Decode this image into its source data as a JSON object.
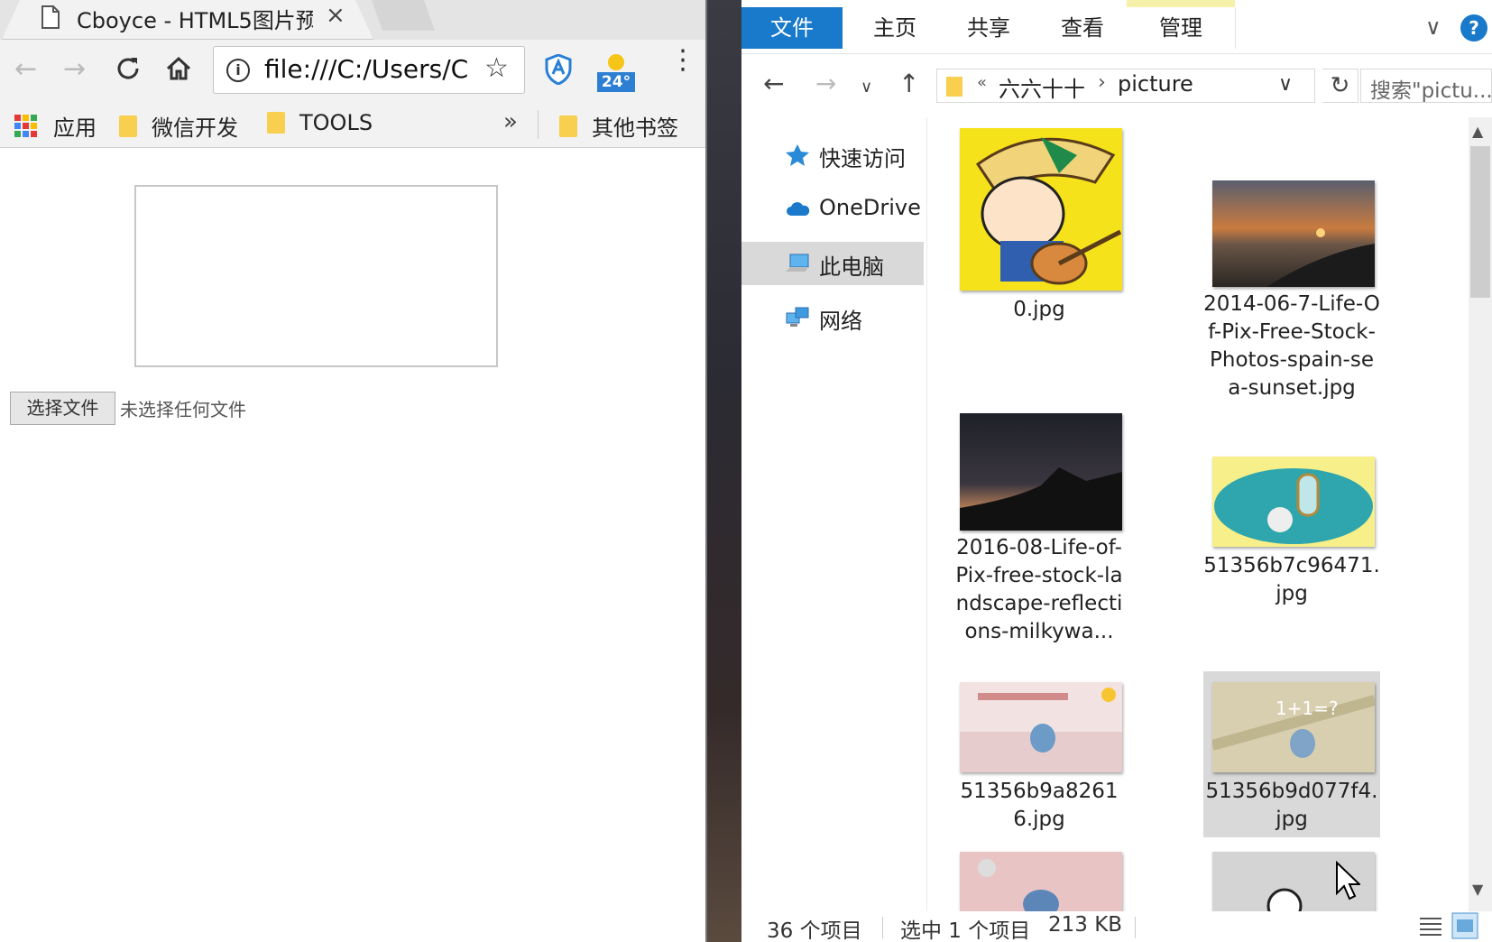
{
  "browser": {
    "tab_title": "Cboyce - HTML5图片预",
    "tab_close": "×",
    "url": "file:///C:/Users/Ca",
    "weather_temp": "24°",
    "bookmarks": {
      "apps": "应用",
      "wechat": "微信开发",
      "tools": "TOOLS",
      "more": "»",
      "other": "其他书签"
    }
  },
  "page": {
    "choose_file_label": "选择文件",
    "no_file_text": "未选择任何文件"
  },
  "explorer": {
    "ribbon_tabs": [
      "文件",
      "主页",
      "共享",
      "查看",
      "管理"
    ],
    "breadcrumb": [
      "六六十十",
      "picture"
    ],
    "search_placeholder": "搜索\"pictu...",
    "nav": [
      {
        "label": "快速访问"
      },
      {
        "label": "OneDrive"
      },
      {
        "label": "此电脑"
      },
      {
        "label": "网络"
      }
    ],
    "files": [
      {
        "name": "0.jpg"
      },
      {
        "name": "2014-06-7-Life-Of-Pix-Free-Stock-Photos-spain-sea-sunset.jpg"
      },
      {
        "name": "2016-08-Life-of-Pix-free-stock-landscape-reflections-milkywa..."
      },
      {
        "name": "51356b7c96471.jpg"
      },
      {
        "name": "51356b9a82616.jpg"
      },
      {
        "name": "51356b9d077f4.jpg"
      }
    ],
    "status": {
      "item_count": "36 个项目",
      "selected": "选中 1 个项目",
      "size": "213 KB"
    }
  }
}
